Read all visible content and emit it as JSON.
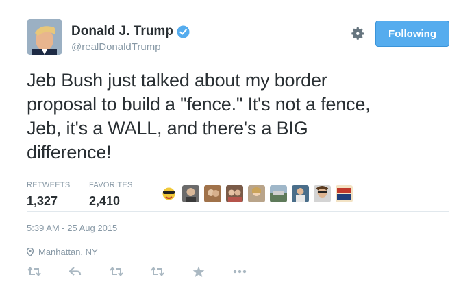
{
  "author": {
    "name": "Donald J. Trump",
    "handle": "@realDonaldTrump",
    "verified": true
  },
  "follow_button": {
    "label": "Following",
    "color": "#55acee"
  },
  "tweet": {
    "lines": [
      "Jeb Bush just talked about my border",
      "proposal to build a \"fence.\" It's not a fence,",
      "Jeb, it's a WALL, and there's a BIG",
      "difference!"
    ]
  },
  "stats": {
    "retweets_label": "RETWEETS",
    "retweets": "1,327",
    "favorites_label": "FAVORITES",
    "favorites": "2,410"
  },
  "favoriters_count_shown": 9,
  "timestamp": "5:39 AM - 25 Aug 2015",
  "location": "Manhattan, NY",
  "actions": [
    "retweet-icon",
    "reply-icon",
    "retweet-icon",
    "retweet-icon",
    "favorite-star-icon",
    "more-dots-icon"
  ],
  "colors": {
    "muted": "#8899a6",
    "text": "#292f33",
    "accent": "#55acee",
    "divider": "#e1e8ed"
  }
}
